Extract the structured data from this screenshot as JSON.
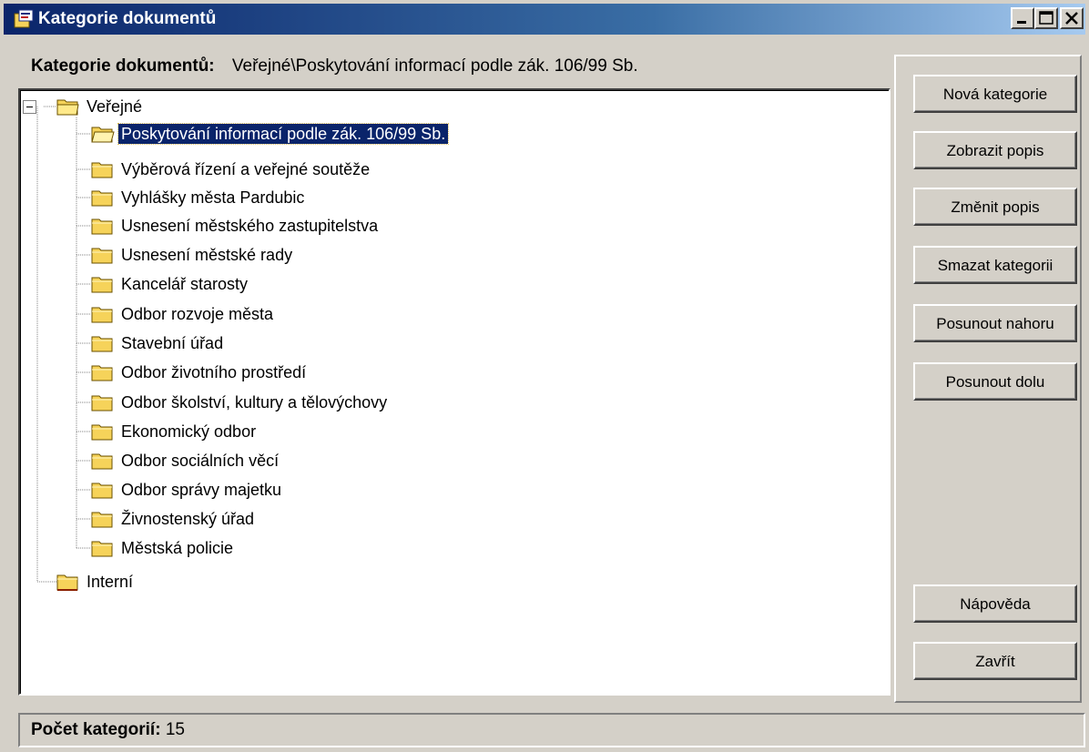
{
  "window": {
    "title": "Kategorie dokumentů",
    "controls": [
      "minimize-icon",
      "maximize-icon",
      "close-icon"
    ]
  },
  "header": {
    "label": "Kategorie dokumentů:",
    "path": "Veřejné\\Poskytování informací podle zák. 106/99 Sb."
  },
  "tree": {
    "root_public": {
      "label": "Veřejné",
      "expanded": true,
      "children": [
        "Poskytování informací podle zák. 106/99 Sb.",
        "Výběrová řízení a veřejné soutěže",
        "Vyhlášky města Pardubic",
        "Usnesení městského zastupitelstva",
        "Usnesení městské rady",
        "Kancelář starosty",
        "Odbor rozvoje města",
        "Stavební úřad",
        "Odbor životního prostředí",
        "Odbor školství, kultury a tělovýchovy",
        "Ekonomický odbor",
        "Odbor sociálních věcí",
        "Odbor správy majetku",
        "Živnostenský úřad",
        "Městská policie"
      ],
      "selected_child": "Poskytování informací podle zák. 106/99 Sb."
    },
    "root_internal": {
      "label": "Interní"
    }
  },
  "buttons": {
    "new_category": "Nová kategorie",
    "show_description": "Zobrazit popis",
    "change_description": "Změnit popis",
    "delete_category": "Smazat kategorii",
    "move_up": "Posunout nahoru",
    "move_down": "Posunout dolu",
    "help": "Nápověda",
    "close": "Zavřít"
  },
  "status": {
    "label": "Počet kategorií:",
    "count": "15"
  },
  "colors": {
    "titlebar_start": "#0a246a",
    "titlebar_end": "#a6caf0",
    "face": "#d4d0c8",
    "selection": "#0a246a",
    "folder": "#f6d35a"
  }
}
